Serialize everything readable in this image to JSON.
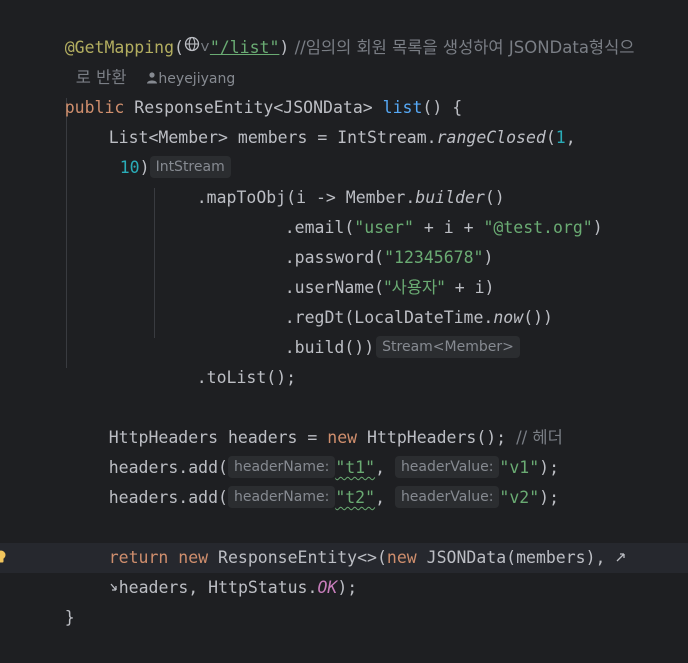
{
  "code": {
    "l1": {
      "annotation": "@GetMapping",
      "open": "(",
      "dropdown_arrow": "˅",
      "path": "\"/list\"",
      "close": ")",
      "comment": " //임의의 회원 목록을 생성하여 JSONData형식으"
    },
    "l2": {
      "text": "로 반환",
      "author": "heyejiyang"
    },
    "l3": {
      "kw": "public",
      "type": " ResponseEntity<JSONData> ",
      "method": "list",
      "rest": "() {"
    },
    "l4": {
      "text": "List<Member> members = IntStream.",
      "method": "rangeClosed",
      "paren": "(",
      "num": "1",
      "comma": ","
    },
    "l5": {
      "num": "10",
      "paren": ")",
      "hint": "IntStream"
    },
    "l6": {
      "text1": ".mapToObj(i -> Member.",
      "method": "builder",
      "text2": "()"
    },
    "l7": {
      "text1": ".email(",
      "str1": "\"user\"",
      "text2": " + i + ",
      "str2": "\"@test.org\"",
      "text3": ")"
    },
    "l8": {
      "text1": ".password(",
      "str": "\"12345678\"",
      "text2": ")"
    },
    "l9": {
      "text1": ".userName(",
      "str": "\"사용자\"",
      "text2": " + i)"
    },
    "l10": {
      "text1": ".regDt(LocalDateTime.",
      "method": "now",
      "text2": "())"
    },
    "l11": {
      "text": ".build())",
      "hint": "Stream<Member>"
    },
    "l12": {
      "text": ".toList();"
    },
    "l14": {
      "text1": "HttpHeaders headers = ",
      "kw": "new",
      "text2": " HttpHeaders(); ",
      "comment": "// 헤더"
    },
    "l15": {
      "text1": "headers.add(",
      "hint1": "headerName:",
      "str1": "\"t1\"",
      "comma": ", ",
      "hint2": "headerValue:",
      "str2": "\"v1\"",
      "text2": ");"
    },
    "l16": {
      "text1": "headers.add(",
      "hint1": "headerName:",
      "str1": "\"t2\"",
      "comma": ", ",
      "hint2": "headerValue:",
      "str2": "\"v2\"",
      "text2": ");"
    },
    "l18": {
      "kw1": "return",
      "kw2": "new",
      "text1": " ResponseEntity<>(",
      "kw3": "new",
      "text2": " JSONData(members), "
    },
    "l19": {
      "text1": "headers, HttpStatus.",
      "const": "OK",
      "text2": ");"
    },
    "l20": {
      "text": "}"
    }
  },
  "icons": {
    "globe": "globe-icon",
    "user": "user-icon",
    "bulb": "lightbulb-icon",
    "wrap_start": "soft-wrap-icon",
    "wrap_end": "soft-wrap-continue-icon"
  },
  "colors": {
    "background": "#1e1f22",
    "keyword": "#cf8e6d",
    "function": "#56a8f5",
    "string": "#6aab73",
    "number": "#2aacb8",
    "comment": "#7a7e85",
    "annotation": "#b3ae60",
    "constant": "#c77dbb"
  }
}
